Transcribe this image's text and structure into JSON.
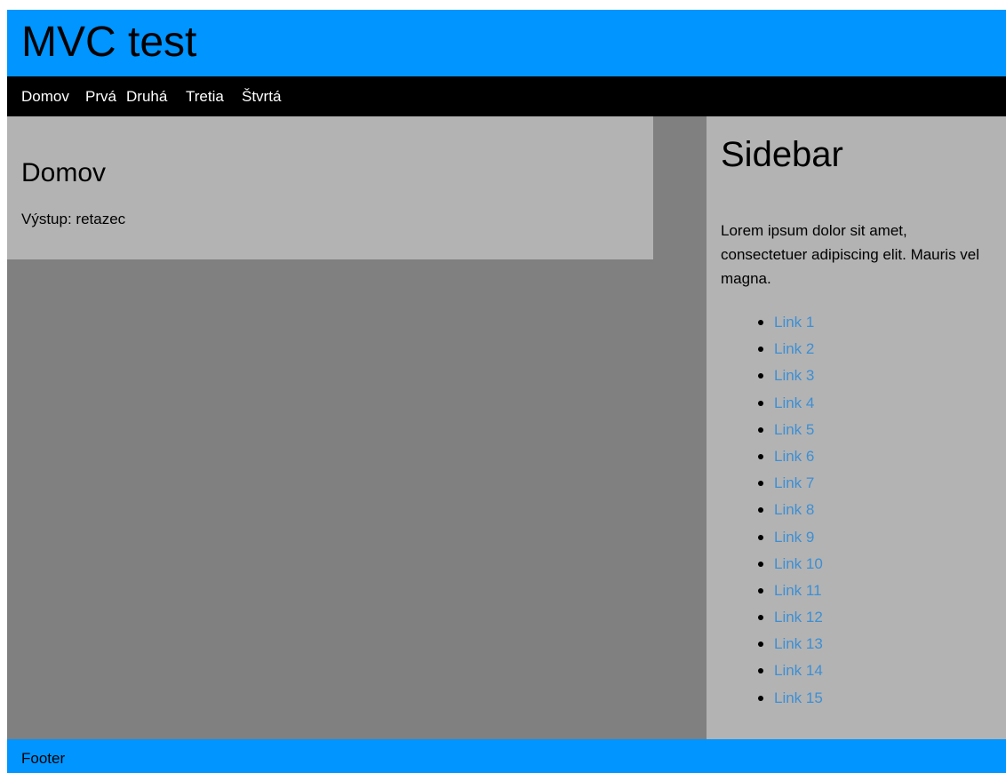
{
  "header": {
    "title": "MVC test"
  },
  "nav": {
    "items": [
      "Domov",
      "Prvá",
      "Druhá",
      "Tretia",
      "Štvrtá"
    ]
  },
  "content": {
    "title": "Domov",
    "output": "Výstup: retazec"
  },
  "sidebar": {
    "title": "Sidebar",
    "text": "Lorem ipsum dolor sit amet, consectetuer adipiscing elit. Mauris vel magna.",
    "links": [
      "Link 1",
      "Link 2",
      "Link 3",
      "Link 4",
      "Link 5",
      "Link 6",
      "Link 7",
      "Link 8",
      "Link 9",
      "Link 10",
      "Link 11",
      "Link 12",
      "Link 13",
      "Link 14",
      "Link 15"
    ]
  },
  "footer": {
    "text": "Footer"
  },
  "colors": {
    "header_bg": "#0095ff",
    "nav_bg": "#000000",
    "page_bg": "#808080",
    "panel_bg": "#b3b3b3",
    "link": "#3d8fd4"
  }
}
